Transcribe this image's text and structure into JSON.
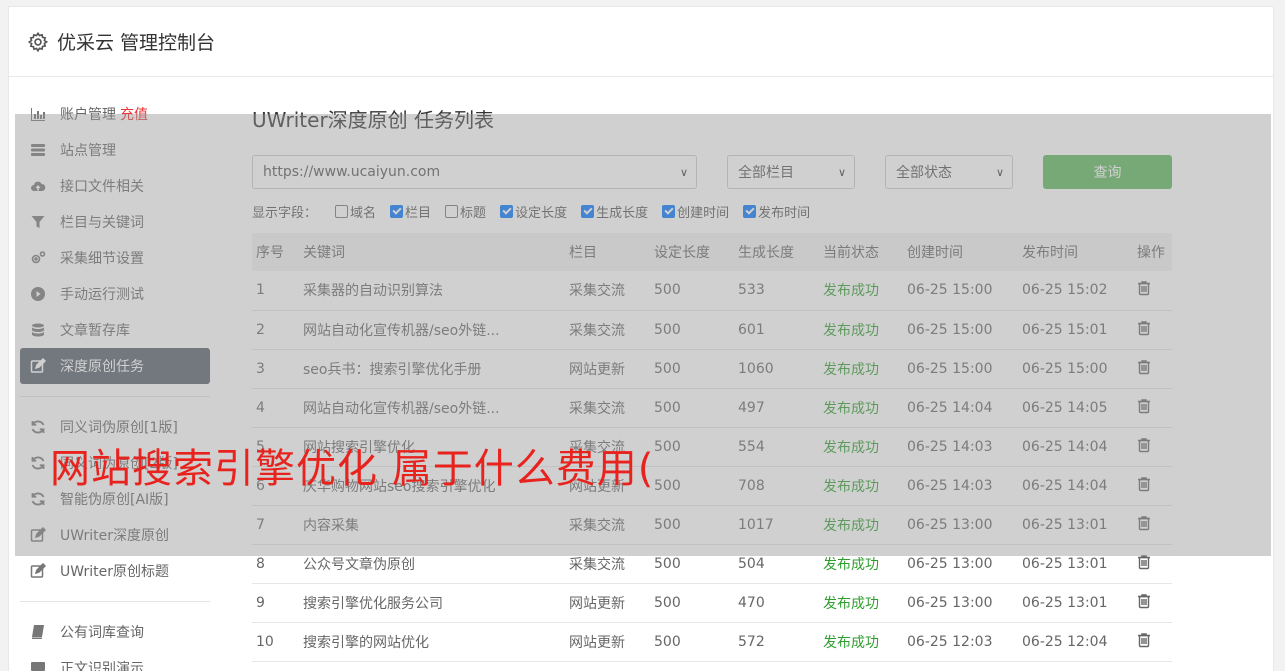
{
  "header": {
    "title": "优采云 管理控制台"
  },
  "sidebar": {
    "group1": [
      {
        "icon": "bar-chart-icon",
        "label": "账户管理",
        "extra": "充值"
      },
      {
        "icon": "server-icon",
        "label": "站点管理"
      },
      {
        "icon": "cloud-upload-icon",
        "label": "接口文件相关"
      },
      {
        "icon": "filter-icon",
        "label": "栏目与关键词"
      },
      {
        "icon": "cogs-icon",
        "label": "采集细节设置"
      },
      {
        "icon": "play-circle-icon",
        "label": "手动运行测试"
      },
      {
        "icon": "database-icon",
        "label": "文章暂存库"
      },
      {
        "icon": "edit-icon",
        "label": "深度原创任务",
        "active": true
      }
    ],
    "group2": [
      {
        "icon": "refresh-icon",
        "label": "同义词伪原创[1版]"
      },
      {
        "icon": "refresh-icon",
        "label": "同义词伪原创[2版]"
      },
      {
        "icon": "refresh-icon",
        "label": "智能伪原创[AI版]"
      },
      {
        "icon": "edit-icon",
        "label": "UWriter深度原创"
      },
      {
        "icon": "edit-icon",
        "label": "UWriter原创标题"
      }
    ],
    "group3": [
      {
        "icon": "book-icon",
        "label": "公有词库查询"
      },
      {
        "icon": "monitor-icon",
        "label": "正文识别演示"
      }
    ]
  },
  "main": {
    "title": "UWriter深度原创 任务列表",
    "site_select": "https://www.ucaiyun.com",
    "column_select": "全部栏目",
    "status_select": "全部状态",
    "query_label": "查询",
    "fields_label": "显示字段：",
    "fields": [
      {
        "label": "域名",
        "checked": false
      },
      {
        "label": "栏目",
        "checked": true
      },
      {
        "label": "标题",
        "checked": false
      },
      {
        "label": "设定长度",
        "checked": true
      },
      {
        "label": "生成长度",
        "checked": true
      },
      {
        "label": "创建时间",
        "checked": true
      },
      {
        "label": "发布时间",
        "checked": true
      }
    ],
    "columns": [
      "序号",
      "关键词",
      "栏目",
      "设定长度",
      "生成长度",
      "当前状态",
      "创建时间",
      "发布时间",
      "操作"
    ],
    "rows": [
      [
        "1",
        "采集器的自动识别算法",
        "采集交流",
        "500",
        "533",
        "发布成功",
        "06-25 15:00",
        "06-25 15:02"
      ],
      [
        "2",
        "网站自动化宣传机器/seo外链...",
        "采集交流",
        "500",
        "601",
        "发布成功",
        "06-25 15:00",
        "06-25 15:01"
      ],
      [
        "3",
        "seo兵书：搜索引擎优化手册",
        "网站更新",
        "500",
        "1060",
        "发布成功",
        "06-25 15:00",
        "06-25 15:00"
      ],
      [
        "4",
        "网站自动化宣传机器/seo外链...",
        "采集交流",
        "500",
        "497",
        "发布成功",
        "06-25 14:04",
        "06-25 14:05"
      ],
      [
        "5",
        "网站搜索引擎优化",
        "采集交流",
        "500",
        "554",
        "发布成功",
        "06-25 14:03",
        "06-25 14:04"
      ],
      [
        "6",
        "庆华购物网站seo搜索引擎优化",
        "网站更新",
        "500",
        "708",
        "发布成功",
        "06-25 14:03",
        "06-25 14:04"
      ],
      [
        "7",
        "内容采集",
        "采集交流",
        "500",
        "1017",
        "发布成功",
        "06-25 13:00",
        "06-25 13:01"
      ],
      [
        "8",
        "公众号文章伪原创",
        "采集交流",
        "500",
        "504",
        "发布成功",
        "06-25 13:00",
        "06-25 13:01"
      ],
      [
        "9",
        "搜索引擎优化服务公司",
        "网站更新",
        "500",
        "470",
        "发布成功",
        "06-25 13:00",
        "06-25 13:01"
      ],
      [
        "10",
        "搜索引擎的网站优化",
        "网站更新",
        "500",
        "572",
        "发布成功",
        "06-25 12:03",
        "06-25 12:04"
      ]
    ]
  },
  "overlay": {
    "text": "网站搜索引擎优化 属于什么费用("
  },
  "colors": {
    "active_sidebar": "#565d6a",
    "query_button": "#5cb85c",
    "status_ok": "#2f9e2f",
    "overlay_text": "#e8231e"
  }
}
